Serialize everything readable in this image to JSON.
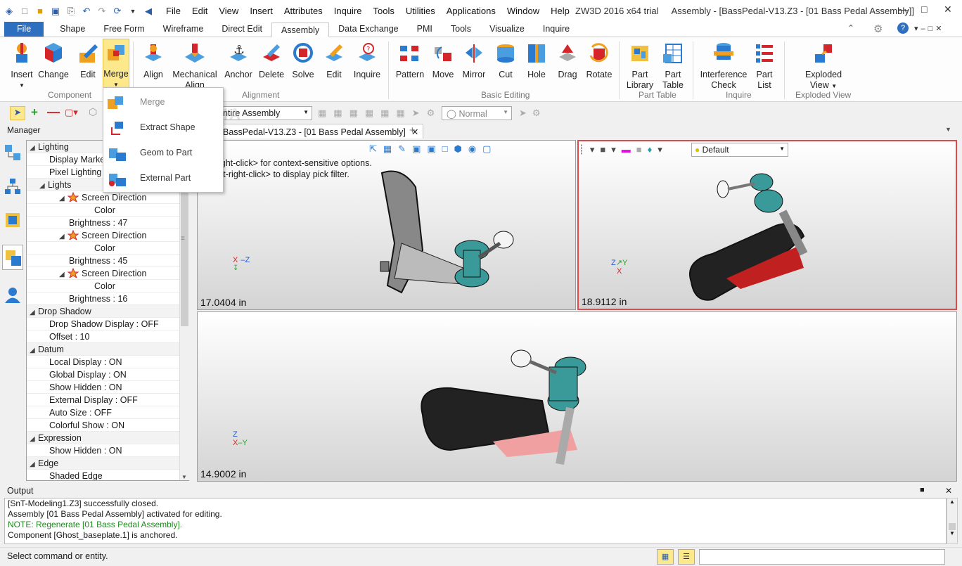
{
  "title": "ZW3D 2016  x64 trial",
  "doc_title": "Assembly - [BassPedal-V13.Z3 - [01 Bass Pedal Assembly]]",
  "menu": [
    "File",
    "Edit",
    "View",
    "Insert",
    "Attributes",
    "Inquire",
    "Tools",
    "Utilities",
    "Applications",
    "Window",
    "Help"
  ],
  "tabs": [
    "File",
    "Shape",
    "Free Form",
    "Wireframe",
    "Direct Edit",
    "Assembly",
    "Data Exchange",
    "PMI",
    "Tools",
    "Visualize",
    "Inquire"
  ],
  "active_tab": "Assembly",
  "ribbon": {
    "component": {
      "label": "Component",
      "insert": "Insert",
      "change": "Change",
      "edit": "Edit",
      "merge": "Merge"
    },
    "alignment": {
      "label": "Alignment",
      "align": "Align",
      "mech1": "Mechanical",
      "mech2": "Align",
      "anchor": "Anchor",
      "delete": "Delete",
      "solve": "Solve",
      "edit": "Edit",
      "inquire": "Inquire"
    },
    "basic_editing": {
      "label": "Basic Editing",
      "pattern": "Pattern",
      "move": "Move",
      "mirror": "Mirror",
      "cut": "Cut",
      "hole": "Hole",
      "drag": "Drag",
      "rotate": "Rotate"
    },
    "part_table": {
      "label": "Part Table",
      "lib1": "Part",
      "lib2": "Library",
      "tab1": "Part",
      "tab2": "Table"
    },
    "inquire": {
      "label": "Inquire",
      "ic1": "Interference",
      "ic2": "Check",
      "pl1": "Part",
      "pl2": "List"
    },
    "exploded": {
      "label": "Exploded View",
      "ev1": "Exploded",
      "ev2": "View"
    }
  },
  "merge_menu": {
    "merge": "Merge",
    "extract": "Extract Shape",
    "geom": "Geom to Part",
    "external": "External Part"
  },
  "toolbar": {
    "filter": "ntire Assembly",
    "mode": "Normal"
  },
  "manager_label": "Manager",
  "tree": [
    {
      "t": "Lighting",
      "lv": 0,
      "exp": true,
      "sec": true
    },
    {
      "t": "Display Marker",
      "lv": 1
    },
    {
      "t": "Pixel Lighting : ",
      "lv": 1
    },
    {
      "t": "Lights",
      "lv": 0,
      "exp": true,
      "sec": true,
      "ind": 1
    },
    {
      "t": "Screen Direction",
      "lv": 2,
      "exp": true,
      "lamp": true
    },
    {
      "t": "Color",
      "lv": 4
    },
    {
      "t": "Brightness : 47",
      "lv": 3
    },
    {
      "t": "Screen Direction",
      "lv": 2,
      "exp": true,
      "lamp": true
    },
    {
      "t": "Color",
      "lv": 4
    },
    {
      "t": "Brightness : 45",
      "lv": 3
    },
    {
      "t": "Screen Direction",
      "lv": 2,
      "exp": true,
      "lamp": true
    },
    {
      "t": "Color",
      "lv": 4
    },
    {
      "t": "Brightness : 16",
      "lv": 3
    },
    {
      "t": "Drop Shadow",
      "lv": 0,
      "exp": true,
      "sec": true
    },
    {
      "t": "Drop Shadow Display : OFF",
      "lv": 1
    },
    {
      "t": "Offset : 10",
      "lv": 1
    },
    {
      "t": "Datum",
      "lv": 0,
      "exp": true,
      "sec": true
    },
    {
      "t": "Local Display : ON",
      "lv": 1
    },
    {
      "t": "Global Display : ON",
      "lv": 1
    },
    {
      "t": "Show Hidden : ON",
      "lv": 1
    },
    {
      "t": "External Display : OFF",
      "lv": 1
    },
    {
      "t": "Auto Size : OFF",
      "lv": 1
    },
    {
      "t": "Colorful Show : ON",
      "lv": 1
    },
    {
      "t": "Expression",
      "lv": 0,
      "exp": true,
      "sec": true
    },
    {
      "t": "Show Hidden : ON",
      "lv": 1
    },
    {
      "t": "Edge",
      "lv": 0,
      "exp": true,
      "sec": true
    },
    {
      "t": "Shaded Edge",
      "lv": 1,
      "exp": true
    }
  ],
  "doc_tab": "BassPedal-V13.Z3 - [01 Bass Pedal Assembly]",
  "hint1": "ight-click> for context-sensitive options.",
  "hint2": "ift-right-click> to display pick filter.",
  "viewports": {
    "vp1": "17.0404 in",
    "vp2": "18.9112 in",
    "vp3": "14.9002 in"
  },
  "render_mode": "Default",
  "output_label": "Output",
  "output": [
    {
      "t": "[SnT-Modeling1.Z3] successfully closed.",
      "c": ""
    },
    {
      "t": "Assembly [01 Bass Pedal Assembly] activated for editing.",
      "c": ""
    },
    {
      "t": "NOTE: Regenerate [01 Bass Pedal Assembly].",
      "c": "note"
    },
    {
      "t": "Component [Ghost_baseplate.1] is anchored.",
      "c": ""
    }
  ],
  "status": "Select command or entity.",
  "watermark": "SOFTPEDIA"
}
